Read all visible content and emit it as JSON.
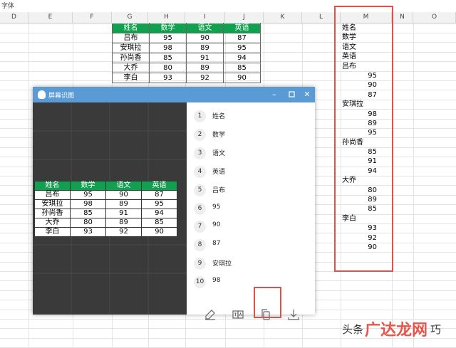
{
  "sheet": {
    "top_text": "字体",
    "columns": [
      "D",
      "E",
      "F",
      "G",
      "H",
      "I",
      "J",
      "K",
      "L",
      "M",
      "N",
      "O"
    ],
    "source_table": {
      "headers": [
        "姓名",
        "数学",
        "语文",
        "英语"
      ],
      "rows": [
        [
          "吕布",
          "95",
          "90",
          "87"
        ],
        [
          "安琪拉",
          "98",
          "89",
          "95"
        ],
        [
          "孙尚香",
          "85",
          "91",
          "94"
        ],
        [
          "大乔",
          "80",
          "89",
          "85"
        ],
        [
          "李白",
          "93",
          "92",
          "90"
        ]
      ]
    },
    "m_column": [
      {
        "t": "姓名",
        "k": "txt"
      },
      {
        "t": "数学",
        "k": "txt"
      },
      {
        "t": "语文",
        "k": "txt"
      },
      {
        "t": "英语",
        "k": "txt"
      },
      {
        "t": "吕布",
        "k": "txt"
      },
      {
        "t": "95",
        "k": "num"
      },
      {
        "t": "90",
        "k": "num"
      },
      {
        "t": "87",
        "k": "num"
      },
      {
        "t": "安琪拉",
        "k": "txt"
      },
      {
        "t": "98",
        "k": "num"
      },
      {
        "t": "89",
        "k": "num"
      },
      {
        "t": "95",
        "k": "num"
      },
      {
        "t": "孙尚香",
        "k": "txt"
      },
      {
        "t": "85",
        "k": "num"
      },
      {
        "t": "91",
        "k": "num"
      },
      {
        "t": "94",
        "k": "num"
      },
      {
        "t": "大乔",
        "k": "txt"
      },
      {
        "t": "80",
        "k": "num"
      },
      {
        "t": "89",
        "k": "num"
      },
      {
        "t": "85",
        "k": "num"
      },
      {
        "t": "李白",
        "k": "txt"
      },
      {
        "t": "93",
        "k": "num"
      },
      {
        "t": "92",
        "k": "num"
      },
      {
        "t": "90",
        "k": "num"
      }
    ]
  },
  "ocr_window": {
    "title": "屏幕识图",
    "preview_table": {
      "headers": [
        "姓名",
        "数学",
        "语文",
        "英语"
      ],
      "rows": [
        [
          "吕布",
          "95",
          "90",
          "87"
        ],
        [
          "安琪拉",
          "98",
          "89",
          "95"
        ],
        [
          "孙尚香",
          "85",
          "91",
          "94"
        ],
        [
          "大乔",
          "80",
          "89",
          "85"
        ],
        [
          "李白",
          "93",
          "92",
          "90"
        ]
      ]
    },
    "results": [
      {
        "n": "1",
        "v": "姓名"
      },
      {
        "n": "2",
        "v": "数学"
      },
      {
        "n": "3",
        "v": "语文"
      },
      {
        "n": "4",
        "v": "英语"
      },
      {
        "n": "5",
        "v": "吕布"
      },
      {
        "n": "6",
        "v": "95"
      },
      {
        "n": "7",
        "v": "90"
      },
      {
        "n": "8",
        "v": "87"
      },
      {
        "n": "9",
        "v": "安琪拉"
      },
      {
        "n": "10",
        "v": "98"
      }
    ],
    "toolbar_icons": [
      "edit-icon",
      "translate-icon",
      "copy-icon",
      "download-icon"
    ],
    "accent_color": "#5b9bd5",
    "highlight_color": "#d9534f"
  },
  "watermark": {
    "prefix": "头条",
    "brand": "广达龙网",
    "suffix": "巧"
  }
}
